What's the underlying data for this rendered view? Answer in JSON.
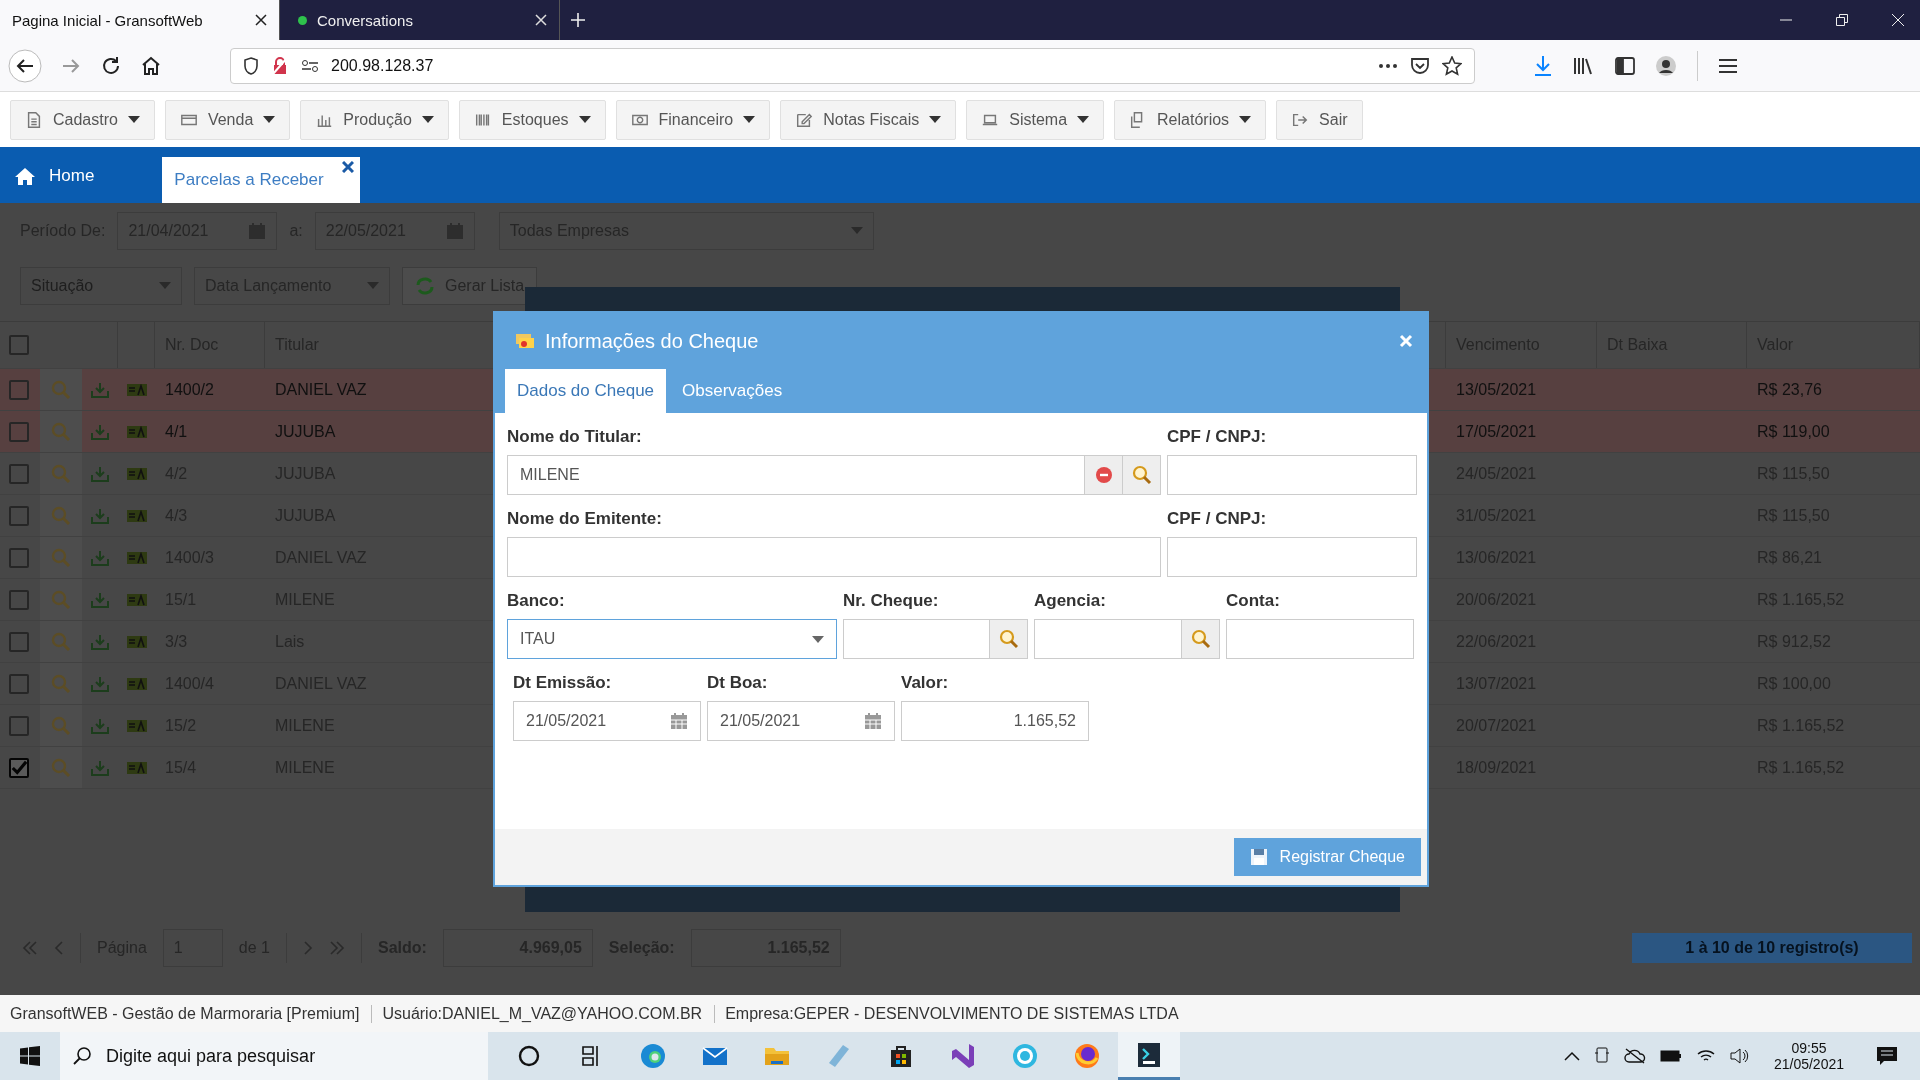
{
  "browser": {
    "tabs": [
      {
        "title": "Pagina Inicial - GransoftWeb",
        "selected": true,
        "indicator": false
      },
      {
        "title": "Conversations",
        "selected": false,
        "indicator": true
      }
    ],
    "url": "200.98.128.37"
  },
  "menu": [
    {
      "label": "Cadastro",
      "dropdown": true,
      "kind": "doc"
    },
    {
      "label": "Venda",
      "dropdown": true,
      "kind": "card"
    },
    {
      "label": "Produção",
      "dropdown": true,
      "kind": "chart"
    },
    {
      "label": "Estoques",
      "dropdown": true,
      "kind": "barcode"
    },
    {
      "label": "Financeiro",
      "dropdown": true,
      "kind": "money"
    },
    {
      "label": "Notas Fiscais",
      "dropdown": true,
      "kind": "edit"
    },
    {
      "label": "Sistema",
      "dropdown": true,
      "kind": "laptop"
    },
    {
      "label": "Relatórios",
      "dropdown": true,
      "kind": "copy"
    },
    {
      "label": "Sair",
      "dropdown": false,
      "kind": "exit"
    }
  ],
  "app_tabs": [
    {
      "label": "Home",
      "selected": false,
      "kind": "home"
    },
    {
      "label": "Parcelas a Receber",
      "selected": true,
      "kind": "closable"
    }
  ],
  "filters": {
    "period_label": "Período De:",
    "date_from": "21/04/2021",
    "to_label": "a:",
    "date_to": "22/05/2021",
    "company": "Todas Empresas",
    "situation_placeholder": "Situação",
    "date_type": "Data Lançamento",
    "generate_button": "Gerar Lista"
  },
  "table": {
    "select_all": false,
    "columns": [
      "Nr. Doc",
      "Titular",
      "Vencimento",
      "Dt Baixa",
      "Valor"
    ],
    "rows": [
      {
        "checked": false,
        "overdue": true,
        "doc": "1400/2",
        "holder": "DANIEL VAZ",
        "due": "13/05/2021",
        "value": "R$ 23,76"
      },
      {
        "checked": false,
        "overdue": true,
        "doc": "4/1",
        "holder": "JUJUBA",
        "due": "17/05/2021",
        "value": "R$ 119,00"
      },
      {
        "checked": false,
        "overdue": false,
        "doc": "4/2",
        "holder": "JUJUBA",
        "due": "24/05/2021",
        "value": "R$ 115,50"
      },
      {
        "checked": false,
        "overdue": false,
        "doc": "4/3",
        "holder": "JUJUBA",
        "due": "31/05/2021",
        "value": "R$ 115,50"
      },
      {
        "checked": false,
        "overdue": false,
        "doc": "1400/3",
        "holder": "DANIEL VAZ",
        "due": "13/06/2021",
        "value": "R$ 86,21"
      },
      {
        "checked": false,
        "overdue": false,
        "doc": "15/1",
        "holder": "MILENE",
        "due": "20/06/2021",
        "value": "R$ 1.165,52"
      },
      {
        "checked": false,
        "overdue": false,
        "doc": "3/3",
        "holder": "Lais",
        "due": "22/06/2021",
        "value": "R$ 912,52"
      },
      {
        "checked": false,
        "overdue": false,
        "doc": "1400/4",
        "holder": "DANIEL VAZ",
        "due": "13/07/2021",
        "value": "R$ 100,00"
      },
      {
        "checked": false,
        "overdue": false,
        "doc": "15/2",
        "holder": "MILENE",
        "due": "20/07/2021",
        "value": "R$ 1.165,52"
      },
      {
        "checked": true,
        "overdue": false,
        "doc": "15/4",
        "holder": "MILENE",
        "due": "18/09/2021",
        "value": "R$ 1.165,52"
      }
    ]
  },
  "pager": {
    "page_label": "Página",
    "page": "1",
    "of": "de 1",
    "balance_label": "Saldo:",
    "balance": "4.969,05",
    "selection_label": "Seleção:",
    "selection": "1.165,52",
    "records": "1 à 10 de 10 registro(s)"
  },
  "dialog": {
    "title": "Informações do Cheque",
    "tabs": [
      {
        "label": "Dados do Cheque",
        "selected": true
      },
      {
        "label": "Observações",
        "selected": false
      }
    ],
    "holder": {
      "label": "Nome do Titular:",
      "value": "MILENE"
    },
    "holder_doc": {
      "label": "CPF / CNPJ:"
    },
    "issuer": {
      "label": "Nome do Emitente:"
    },
    "issuer_doc": {
      "label": "CPF / CNPJ:"
    },
    "bank": {
      "label": "Banco:",
      "value": "ITAU"
    },
    "check_number": {
      "label": "Nr. Cheque:"
    },
    "agency": {
      "label": "Agencia:"
    },
    "account": {
      "label": "Conta:"
    },
    "issue_date": {
      "label": "Dt Emissão:",
      "value": "21/05/2021"
    },
    "good_date": {
      "label": "Dt Boa:",
      "value": "21/05/2021"
    },
    "amount": {
      "label": "Valor:",
      "value": "1.165,52"
    },
    "button": "Registrar Cheque"
  },
  "status_bar": [
    "GransoftWEB - Gestão de Marmoraria [Premium]",
    "Usuário:DANIEL_M_VAZ@YAHOO.COM.BR",
    "Empresa:GEPER - DESENVOLVIMENTO DE SISTEMAS LTDA"
  ],
  "taskbar": {
    "search_placeholder": "Digite aqui para pesquisar",
    "time": "09:55",
    "date": "21/05/2021"
  }
}
